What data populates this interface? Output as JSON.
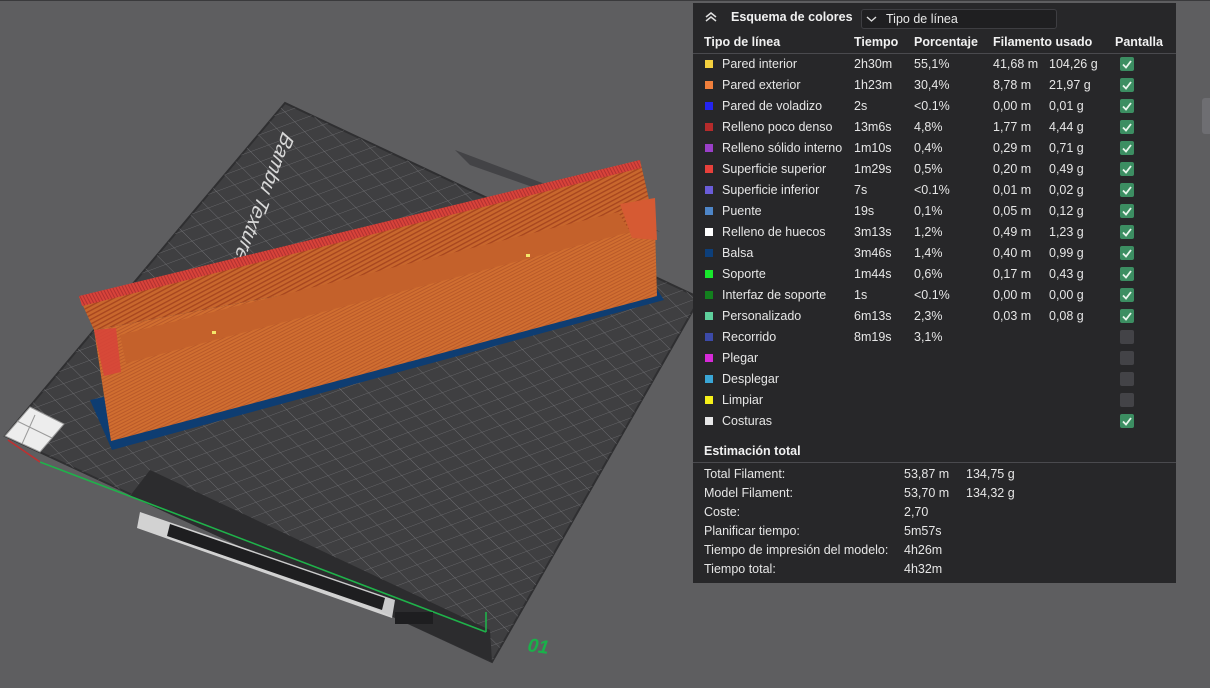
{
  "scene": {
    "plate_brand_text": "Bambu Textured PEI",
    "plate_number": "01"
  },
  "legend": {
    "title": "Esquema de colores",
    "scheme_selected": "Tipo de línea",
    "columns": {
      "type": "Tipo de línea",
      "time": "Tiempo",
      "percent": "Porcentaje",
      "filament": "Filamento usado",
      "display": "Pantalla"
    },
    "rows": [
      {
        "name": "Pared interior",
        "color": "#f4d03f",
        "time": "2h30m",
        "percent": "55,1%",
        "length": "41,68 m",
        "weight": "104,26 g",
        "shown": true
      },
      {
        "name": "Pared exterior",
        "color": "#f07f3c",
        "time": "1h23m",
        "percent": "30,4%",
        "length": "8,78 m",
        "weight": "21,97 g",
        "shown": true
      },
      {
        "name": "Pared de voladizo",
        "color": "#2424f0",
        "time": "2s",
        "percent": "<0.1%",
        "length": "0,00 m",
        "weight": "0,01 g",
        "shown": true
      },
      {
        "name": "Relleno poco denso",
        "color": "#b52b2b",
        "time": "13m6s",
        "percent": "4,8%",
        "length": "1,77 m",
        "weight": "4,44 g",
        "shown": true
      },
      {
        "name": "Relleno sólido interno",
        "color": "#9a3fc8",
        "time": "1m10s",
        "percent": "0,4%",
        "length": "0,29 m",
        "weight": "0,71 g",
        "shown": true
      },
      {
        "name": "Superficie superior",
        "color": "#e8403b",
        "time": "1m29s",
        "percent": "0,5%",
        "length": "0,20 m",
        "weight": "0,49 g",
        "shown": true
      },
      {
        "name": "Superficie inferior",
        "color": "#6a5cd8",
        "time": "7s",
        "percent": "<0.1%",
        "length": "0,01 m",
        "weight": "0,02 g",
        "shown": true
      },
      {
        "name": "Puente",
        "color": "#4e86c8",
        "time": "19s",
        "percent": "0,1%",
        "length": "0,05 m",
        "weight": "0,12 g",
        "shown": true
      },
      {
        "name": "Relleno de huecos",
        "color": "#ffffff",
        "time": "3m13s",
        "percent": "1,2%",
        "length": "0,49 m",
        "weight": "1,23 g",
        "shown": true
      },
      {
        "name": "Balsa",
        "color": "#0d3f7a",
        "time": "3m46s",
        "percent": "1,4%",
        "length": "0,40 m",
        "weight": "0,99 g",
        "shown": true
      },
      {
        "name": "Soporte",
        "color": "#18e82c",
        "time": "1m44s",
        "percent": "0,6%",
        "length": "0,17 m",
        "weight": "0,43 g",
        "shown": true
      },
      {
        "name": "Interfaz de soporte",
        "color": "#13801e",
        "time": "1s",
        "percent": "<0.1%",
        "length": "0,00 m",
        "weight": "0,00 g",
        "shown": true
      },
      {
        "name": "Personalizado",
        "color": "#5ecf9c",
        "time": "6m13s",
        "percent": "2,3%",
        "length": "0,03 m",
        "weight": "0,08 g",
        "shown": true
      },
      {
        "name": "Recorrido",
        "color": "#3c4aa8",
        "time": "8m19s",
        "percent": "3,1%",
        "length": "",
        "weight": "",
        "shown": false
      },
      {
        "name": "Plegar",
        "color": "#d62ad8",
        "time": "",
        "percent": "",
        "length": "",
        "weight": "",
        "shown": false
      },
      {
        "name": "Desplegar",
        "color": "#3aa6d6",
        "time": "",
        "percent": "",
        "length": "",
        "weight": "",
        "shown": false
      },
      {
        "name": "Limpiar",
        "color": "#f6f01a",
        "time": "",
        "percent": "",
        "length": "",
        "weight": "",
        "shown": false
      },
      {
        "name": "Costuras",
        "color": "#e8e8e8",
        "time": "",
        "percent": "",
        "length": "",
        "weight": "",
        "shown": true
      }
    ],
    "total": {
      "title": "Estimación total",
      "rows": [
        {
          "label": "Total Filament:",
          "v1": "53,87 m",
          "v2": "134,75 g"
        },
        {
          "label": "Model Filament:",
          "v1": "53,70 m",
          "v2": "134,32 g"
        },
        {
          "label": "Coste:",
          "v1": "2,70",
          "v2": ""
        },
        {
          "label": "Planificar tiempo:",
          "v1": "5m57s",
          "v2": ""
        },
        {
          "label": "Tiempo de impresión del modelo:",
          "v1": "4h26m",
          "v2": ""
        },
        {
          "label": "Tiempo total:",
          "v1": "4h32m",
          "v2": ""
        }
      ]
    }
  }
}
